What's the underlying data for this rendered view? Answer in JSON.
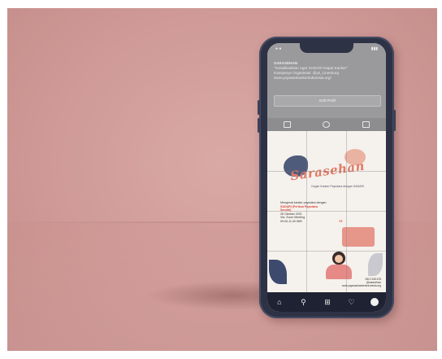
{
  "profile": {
    "name": "SARASEHAN",
    "bio_line1": "\"Sosialisasikan Agar SADARI Dapat Kanker\"",
    "bio_line2": "Kampanye Organisasi: @yk_Lineeburg",
    "bio_line3": "www.yayasankankerindonesia.org/",
    "edit_button": "Edit Profil"
  },
  "post": {
    "title": "Sarasehan",
    "tagline": "Cegah Kanker Payudara dengan SADARI",
    "info_line1": "Mengenal kanker payudara dengan",
    "info_line2": "SADARI (Periksa Payudara Sendiri)",
    "info_line3": "26 Oktober 2021",
    "info_line4": "Via: Zoom Meeting",
    "info_line5": "09.00-11.00 WIB",
    "footer_line1": "0812 345 678",
    "footer_line2": "@sarasehan",
    "footer_line3": "www.yayasankankerindonesia.org"
  },
  "icons": {
    "nav": [
      "home-icon",
      "search-icon",
      "add-post-icon",
      "heart-icon",
      "profile-icon"
    ],
    "tabs": [
      "grid-icon",
      "reels-icon",
      "tagged-icon"
    ]
  },
  "colors": {
    "background": "#cf9a97",
    "phone_body": "#2e3245",
    "accent": "#e07a67"
  }
}
